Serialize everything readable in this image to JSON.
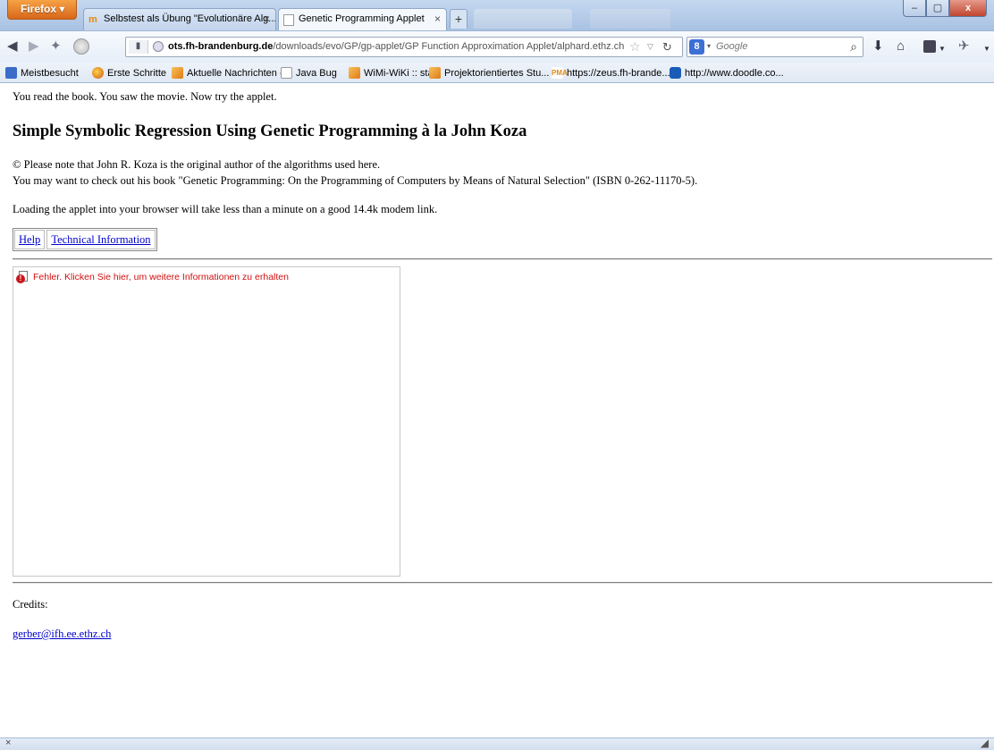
{
  "browser": {
    "menu_button_label": "Firefox",
    "tabs": [
      {
        "label": "Selbstest als Übung \"Evolutionäre Alg...",
        "favicon": "moodle-favicon"
      },
      {
        "label": "Genetic Programming Applet",
        "favicon": "blank-page-favicon"
      }
    ],
    "tab_close_glyph": "×",
    "new_tab_glyph": "+",
    "window_controls": {
      "minimize": "–",
      "maximize": "▢",
      "close": "x"
    },
    "url_host": "ots.fh-brandenburg.de",
    "url_path": "/downloads/evo/GP/gp-applet/GP Function Approximation Applet/alphard.ethz.ch/gerber",
    "search_engine_letter": "8",
    "search_placeholder": "Google",
    "bookmarks": [
      {
        "label": "Meistbesucht",
        "icon": "blue"
      },
      {
        "label": "Erste Schritte",
        "icon": "ff"
      },
      {
        "label": "Aktuelle Nachrichten -...",
        "icon": "rss"
      },
      {
        "label": "Java Bug",
        "icon": "page"
      },
      {
        "label": "WiMi-WiKi :: start",
        "icon": "rss"
      },
      {
        "label": "Projektorientiertes Stu...",
        "icon": "rss"
      },
      {
        "label": "https://zeus.fh-brande...",
        "icon": "pma"
      },
      {
        "label": "http://www.doodle.co...",
        "icon": "doodle"
      }
    ],
    "addon_bar_close_glyph": "×"
  },
  "page": {
    "intro": "You read the book. You saw the movie. Now try the applet.",
    "heading": "Simple Symbolic Regression Using Genetic Programming à la John Koza",
    "copyright_note": "© Please note that John R. Koza is the original author of the algorithms used here.",
    "book_note": "You may want to check out his book \"Genetic Programming: On the Programming of Computers by Means of Natural Selection\" (ISBN 0-262-11170-5).",
    "loading_note": "Loading the applet into your browser will take less than a minute on a good 14.4k modem link.",
    "links": {
      "help": "Help",
      "technical_information": "Technical Information"
    },
    "applet_error": "Fehler. Klicken Sie hier, um weitere Informationen zu erhalten",
    "credits_label": "Credits:",
    "credits_email": "gerber@ifh.ee.ethz.ch"
  },
  "colors": {
    "link": "#0000cc",
    "error_text": "#d01010",
    "firefox_button": "#e07a20",
    "chrome_blue": "#c4d7ef"
  }
}
